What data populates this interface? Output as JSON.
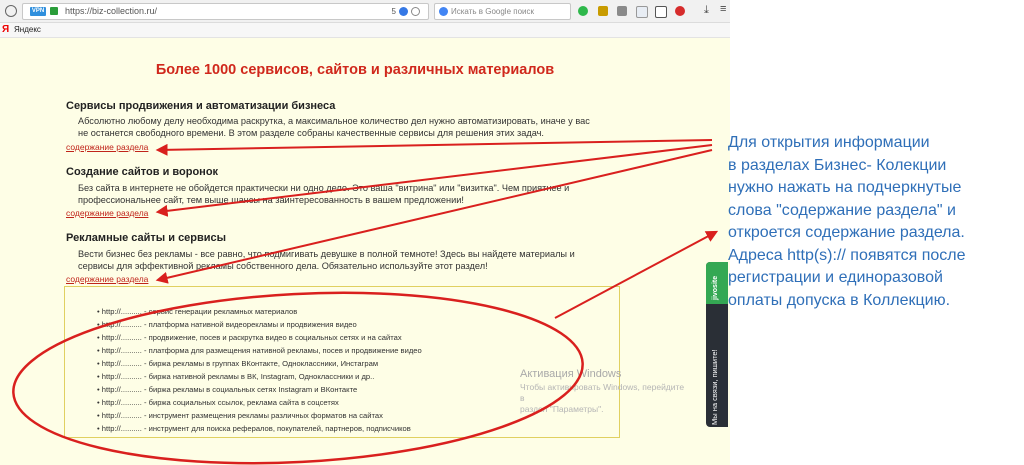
{
  "browser": {
    "vpn_label": "VPN",
    "url": "https://biz-collection.ru/",
    "tab_count": "5",
    "search_placeholder": "Искать в Google поиск",
    "bookmark_yandex": "Яндекс"
  },
  "page": {
    "title": "Более 1000 сервисов, сайтов и различных материалов",
    "sections": [
      {
        "title": "Сервисы продвижения и автоматизации бизнеса",
        "desc_lines": [
          "Абсолютно любому делу необходима раскрутка, а максимальное количество дел нужно автоматизировать, иначе у вас",
          "не останется свободного времени. В этом разделе собраны качественные сервисы для решения этих задач."
        ],
        "link": "содержание раздела"
      },
      {
        "title": "Создание сайтов и воронок",
        "desc_lines": [
          "Без сайта в интернете не обойдется практически ни одно дело. Это ваша \"витрина\" или \"визитка\". Чем приятнее и",
          "профессиональнее сайт, тем выше шансы на заинтересованность в вашем предложении!"
        ],
        "link": "содержание раздела"
      },
      {
        "title": "Рекламные сайты и сервисы",
        "desc_lines": [
          "Вести бизнес без рекламы - все равно, что подмигивать девушке в полной темноте! Здесь вы найдете материалы и",
          "сервисы для эффективной рекламы собственного дела. Обязательно используйте этот раздел!"
        ],
        "link": "содержание раздела"
      }
    ],
    "ad_items": [
      "• http://.......... - сервис генерации рекламных материалов",
      "• http://.......... - платформа нативной видеорекламы и продвижения видео",
      "• http://.......... - продвижение, посев и раскрутка видео в социальных сетях и на сайтах",
      "• http://.......... - платформа для размещения нативной рекламы, посев и продвижение видео",
      "• http://.......... - биржа рекламы в группах ВКонтакте, Одноклассники, Инстаграм",
      "• http://.......... - биржа нативной рекламы в ВК, Instagram, Одноклассники и др..",
      "• http://.......... - биржа рекламы в социальных сетях Instagram и ВКонтакте",
      "• http://.......... - биржа социальных ссылок, реклама сайта в соцсетях",
      "• http://.......... - инструмент размещения рекламы различных форматов на сайтах",
      "• http://.......... - инструмент для поиска рефералов, покупателей, партнеров, подписчиков"
    ]
  },
  "windows_watermark": {
    "title": "Активация Windows",
    "line1": "Чтобы активировать Windows, перейдите в",
    "line2": "раздел \"Параметры\"."
  },
  "side_widget": {
    "brand": "jivosite",
    "text": "Мы на связи, пишите!"
  },
  "annotation": {
    "lines": [
      "Для открытия информации",
      "в разделах Бизнес- Колекции",
      "нужно нажать на подчеркнутые",
      "слова \"содержание раздела\" и",
      "откроется содержание раздела.",
      "Адреса http(s):// появятся после",
      "регистрации и единоразовой",
      " оплаты допуска в Коллекцию."
    ]
  },
  "colors": {
    "page_bg": "#fefee6",
    "title_red": "#d0281c",
    "annotation_blue": "#2f6fb8",
    "arrow_red": "#d9201e"
  }
}
